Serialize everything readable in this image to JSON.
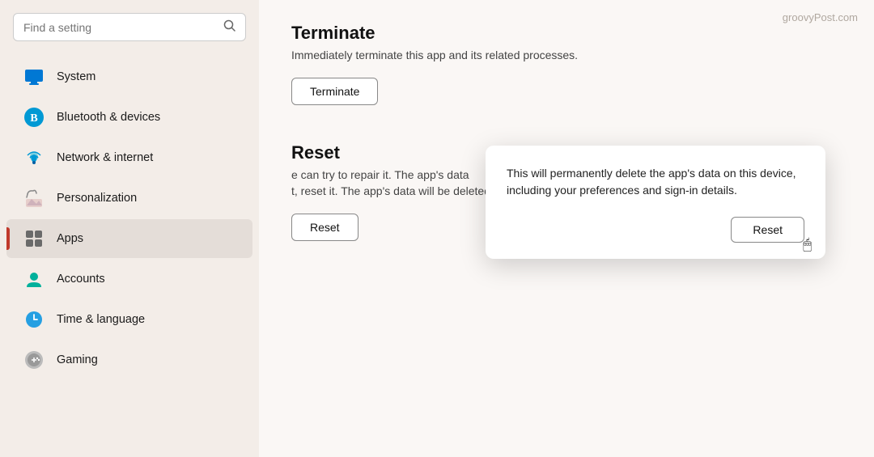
{
  "watermark": "groovyPost.com",
  "sidebar": {
    "search_placeholder": "Find a setting",
    "items": [
      {
        "id": "system",
        "label": "System",
        "icon": "system"
      },
      {
        "id": "bluetooth",
        "label": "Bluetooth & devices",
        "icon": "bluetooth"
      },
      {
        "id": "network",
        "label": "Network & internet",
        "icon": "network"
      },
      {
        "id": "personalization",
        "label": "Personalization",
        "icon": "personalization"
      },
      {
        "id": "apps",
        "label": "Apps",
        "icon": "apps",
        "active": true
      },
      {
        "id": "accounts",
        "label": "Accounts",
        "icon": "accounts"
      },
      {
        "id": "time",
        "label": "Time & language",
        "icon": "time"
      },
      {
        "id": "gaming",
        "label": "Gaming",
        "icon": "gaming"
      }
    ]
  },
  "main": {
    "terminate_title": "Terminate",
    "terminate_desc": "Immediately terminate this app and its related processes.",
    "terminate_button": "Terminate",
    "reset_title": "Reset",
    "reset_desc_partial": "e can try to repair it. The app's data",
    "reset_desc_bottom": "t, reset it. The app's data will be deleted",
    "reset_button": "Reset"
  },
  "dialog": {
    "text": "This will permanently delete the app's data on this device, including your preferences and sign-in details.",
    "reset_button": "Reset"
  }
}
